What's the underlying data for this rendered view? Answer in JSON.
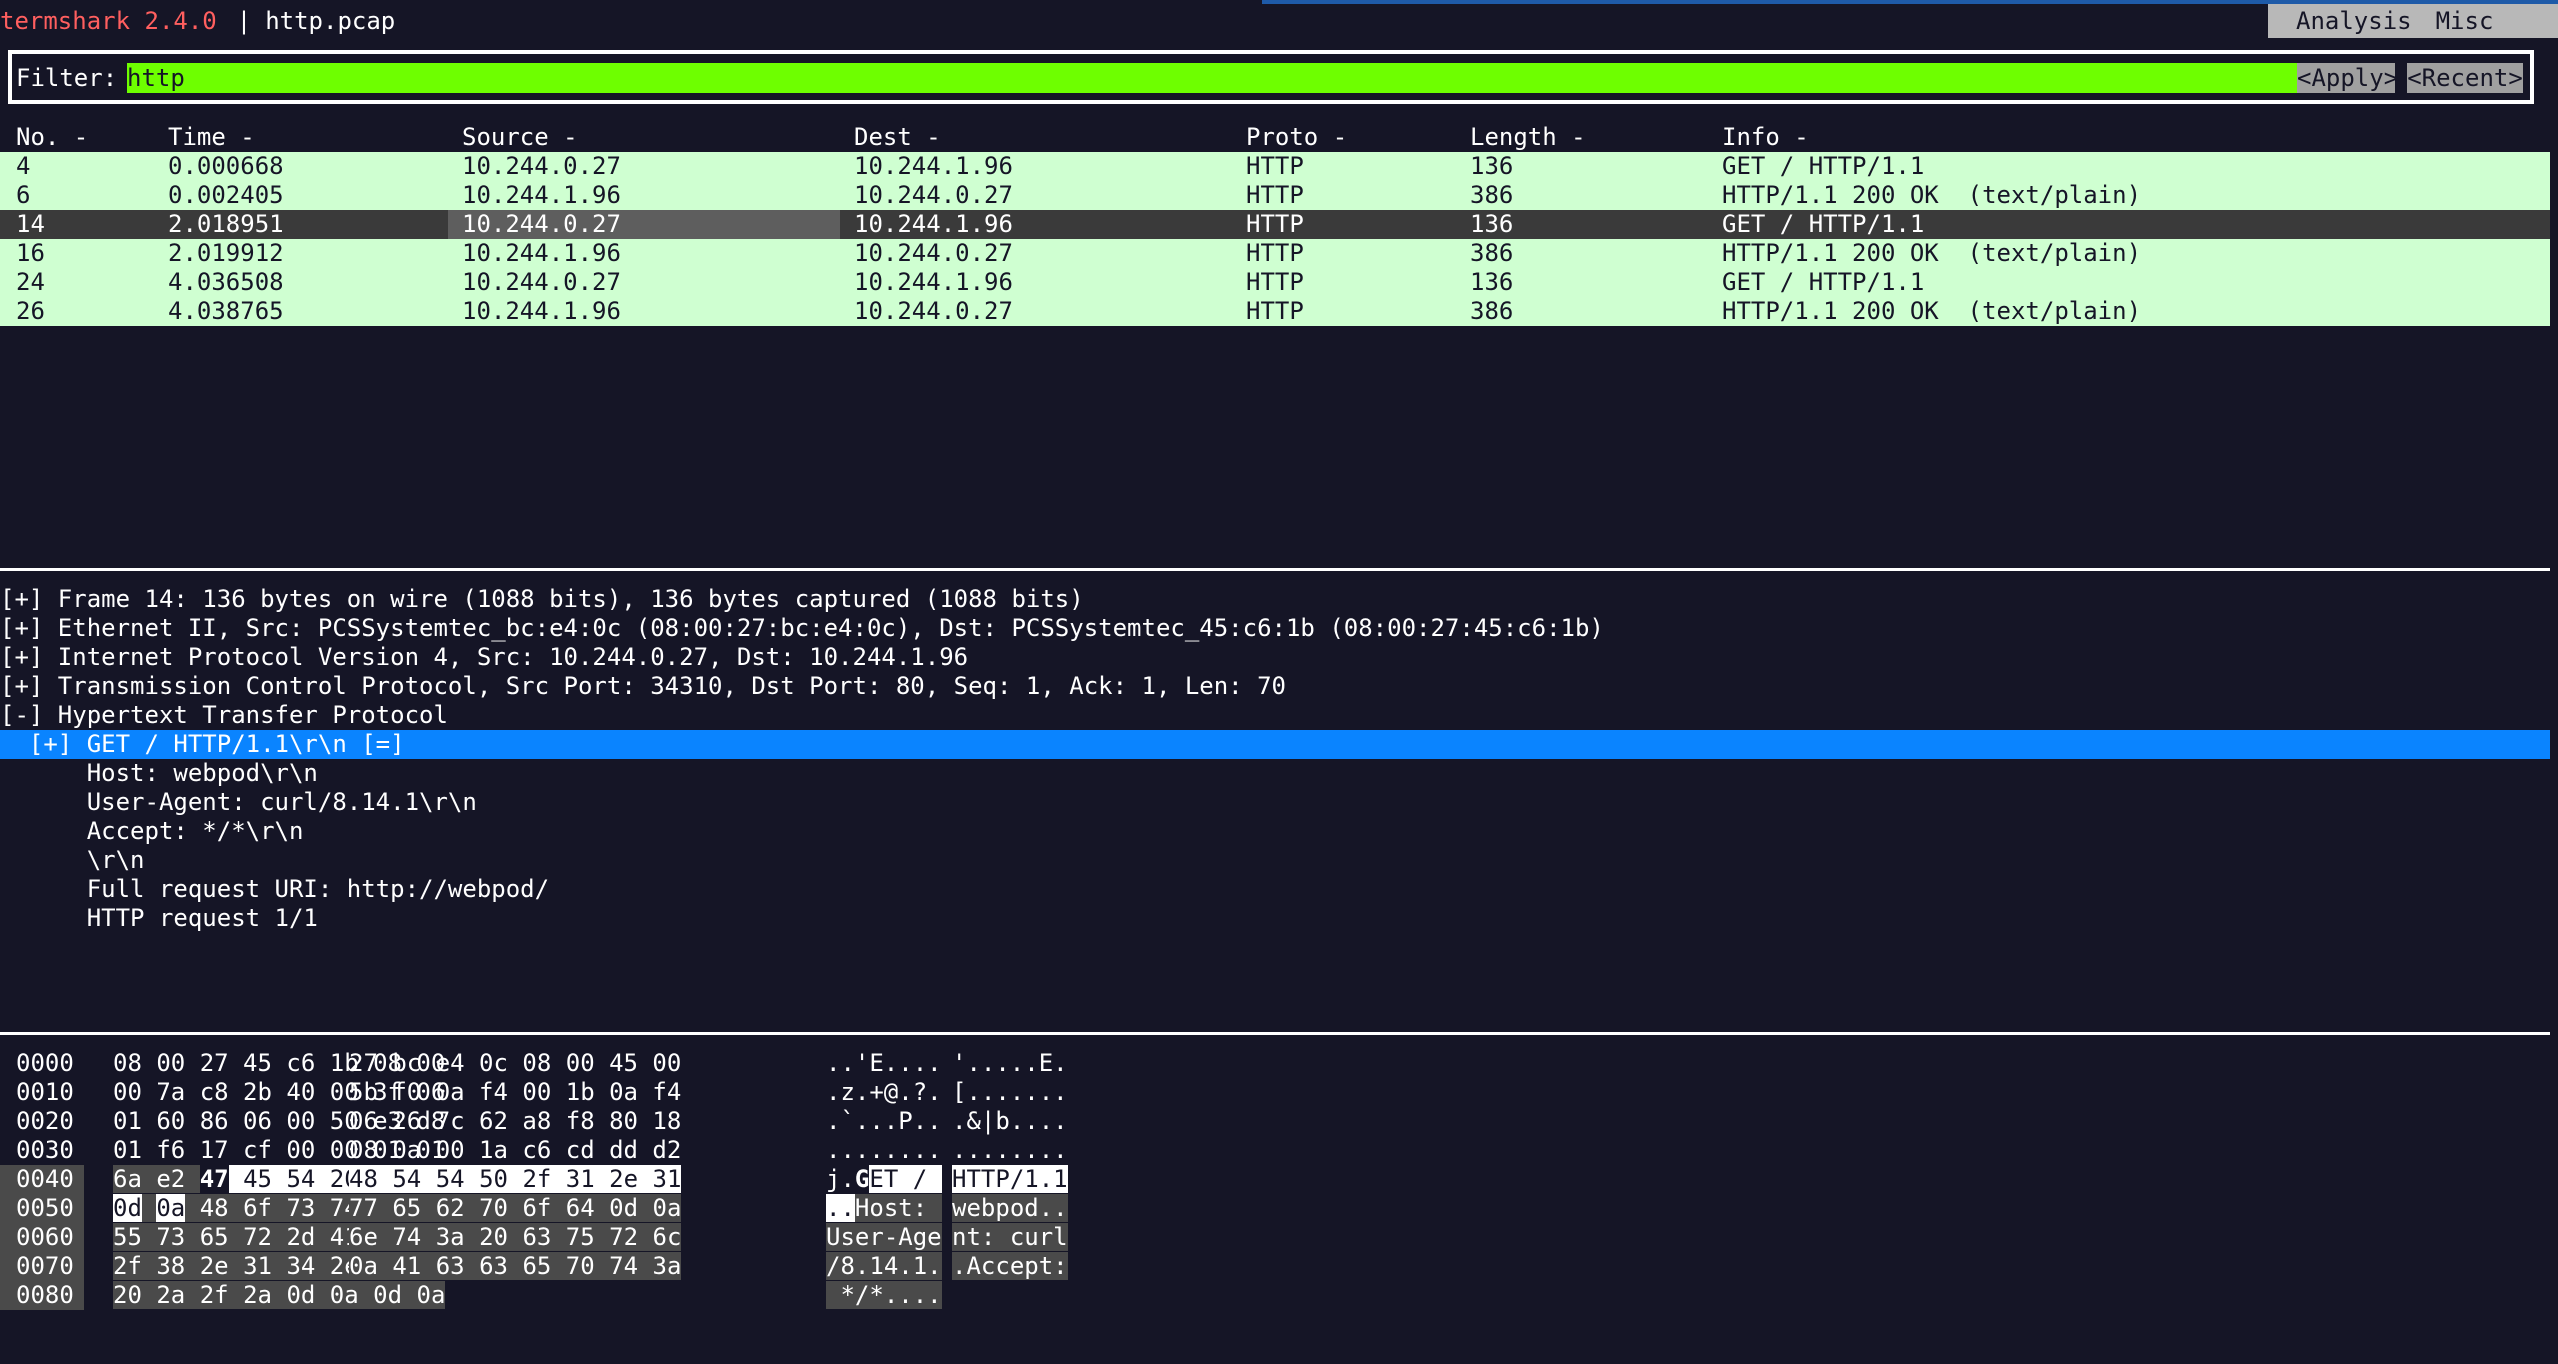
{
  "app": {
    "name": "termshark 2.4.0",
    "separator": "|",
    "file": "http.pcap"
  },
  "menu": [
    "Analysis",
    "Misc"
  ],
  "filter": {
    "label": "Filter:",
    "value": "http",
    "apply": "<Apply>",
    "recent": "<Recent>"
  },
  "packet_list": {
    "columns": [
      "No. -",
      "Time -",
      "Source -",
      "Dest -",
      "Proto -",
      "Length -",
      "Info -"
    ],
    "rows": [
      [
        "4",
        "0.000668",
        "10.244.0.27",
        "10.244.1.96",
        "HTTP",
        "136",
        "GET / HTTP/1.1"
      ],
      [
        "6",
        "0.002405",
        "10.244.1.96",
        "10.244.0.27",
        "HTTP",
        "386",
        "HTTP/1.1 200 OK  (text/plain)"
      ],
      [
        "14",
        "2.018951",
        "10.244.0.27",
        "10.244.1.96",
        "HTTP",
        "136",
        "GET / HTTP/1.1"
      ],
      [
        "16",
        "2.019912",
        "10.244.1.96",
        "10.244.0.27",
        "HTTP",
        "386",
        "HTTP/1.1 200 OK  (text/plain)"
      ],
      [
        "24",
        "4.036508",
        "10.244.0.27",
        "10.244.1.96",
        "HTTP",
        "136",
        "GET / HTTP/1.1"
      ],
      [
        "26",
        "4.038765",
        "10.244.1.96",
        "10.244.0.27",
        "HTTP",
        "386",
        "HTTP/1.1 200 OK  (text/plain)"
      ]
    ],
    "selected_index": 2
  },
  "details": [
    "[+] Frame 14: 136 bytes on wire (1088 bits), 136 bytes captured (1088 bits)",
    "[+] Ethernet II, Src: PCSSystemtec_bc:e4:0c (08:00:27:bc:e4:0c), Dst: PCSSystemtec_45:c6:1b (08:00:27:45:c6:1b)",
    "[+] Internet Protocol Version 4, Src: 10.244.0.27, Dst: 10.244.1.96",
    "[+] Transmission Control Protocol, Src Port: 34310, Dst Port: 80, Seq: 1, Ack: 1, Len: 70",
    "[-] Hypertext Transfer Protocol",
    "  [+] GET / HTTP/1.1\\r\\n [=]",
    "      Host: webpod\\r\\n",
    "      User-Agent: curl/8.14.1\\r\\n",
    "      Accept: */*\\r\\n",
    "      \\r\\n",
    "      Full request URI: http://webpod/",
    "      HTTP request 1/1"
  ],
  "details_selected_index": 5,
  "hex": {
    "offsets": [
      "0000",
      "0010",
      "0020",
      "0030",
      "0040",
      "0050",
      "0060",
      "0070",
      "0080"
    ],
    "bytes": [
      [
        "08 00 27 45 c6 1b 08 00",
        "27 bc e4 0c 08 00 45 00"
      ],
      [
        "00 7a c8 2b 40 00 3f 06",
        "5b f0 0a f4 00 1b 0a f4"
      ],
      [
        "01 60 86 06 00 50 e3 d8",
        "06 26 7c 62 a8 f8 80 18"
      ],
      [
        "01 f6 17 cf 00 00 01 01",
        "08 0a 00 1a c6 cd dd d2"
      ],
      [
        "6a e2 47 45 54 20 2f 20",
        "48 54 54 50 2f 31 2e 31"
      ],
      [
        "0d 0a 48 6f 73 74 3a 20",
        "77 65 62 70 6f 64 0d 0a"
      ],
      [
        "55 73 65 72 2d 41 67 65",
        "6e 74 3a 20 63 75 72 6c"
      ],
      [
        "2f 38 2e 31 34 2e 31 0d",
        "0a 41 63 63 65 70 74 3a"
      ],
      [
        "20 2a 2f 2a 0d 0a 0d 0a",
        ""
      ]
    ],
    "ascii": [
      [
        "..'E....",
        "'.....E."
      ],
      [
        ".z.+@.?.",
        "[......."
      ],
      [
        ".`...P..",
        ".&|b...."
      ],
      [
        "........",
        "........"
      ],
      [
        "j.GET / ",
        "HTTP/1.1"
      ],
      [
        "..Host: ",
        "webpod.."
      ],
      [
        "User-Age",
        "nt: curl"
      ],
      [
        "/8.14.1.",
        ".Accept:"
      ],
      [
        " */*....",
        ""
      ]
    ]
  }
}
